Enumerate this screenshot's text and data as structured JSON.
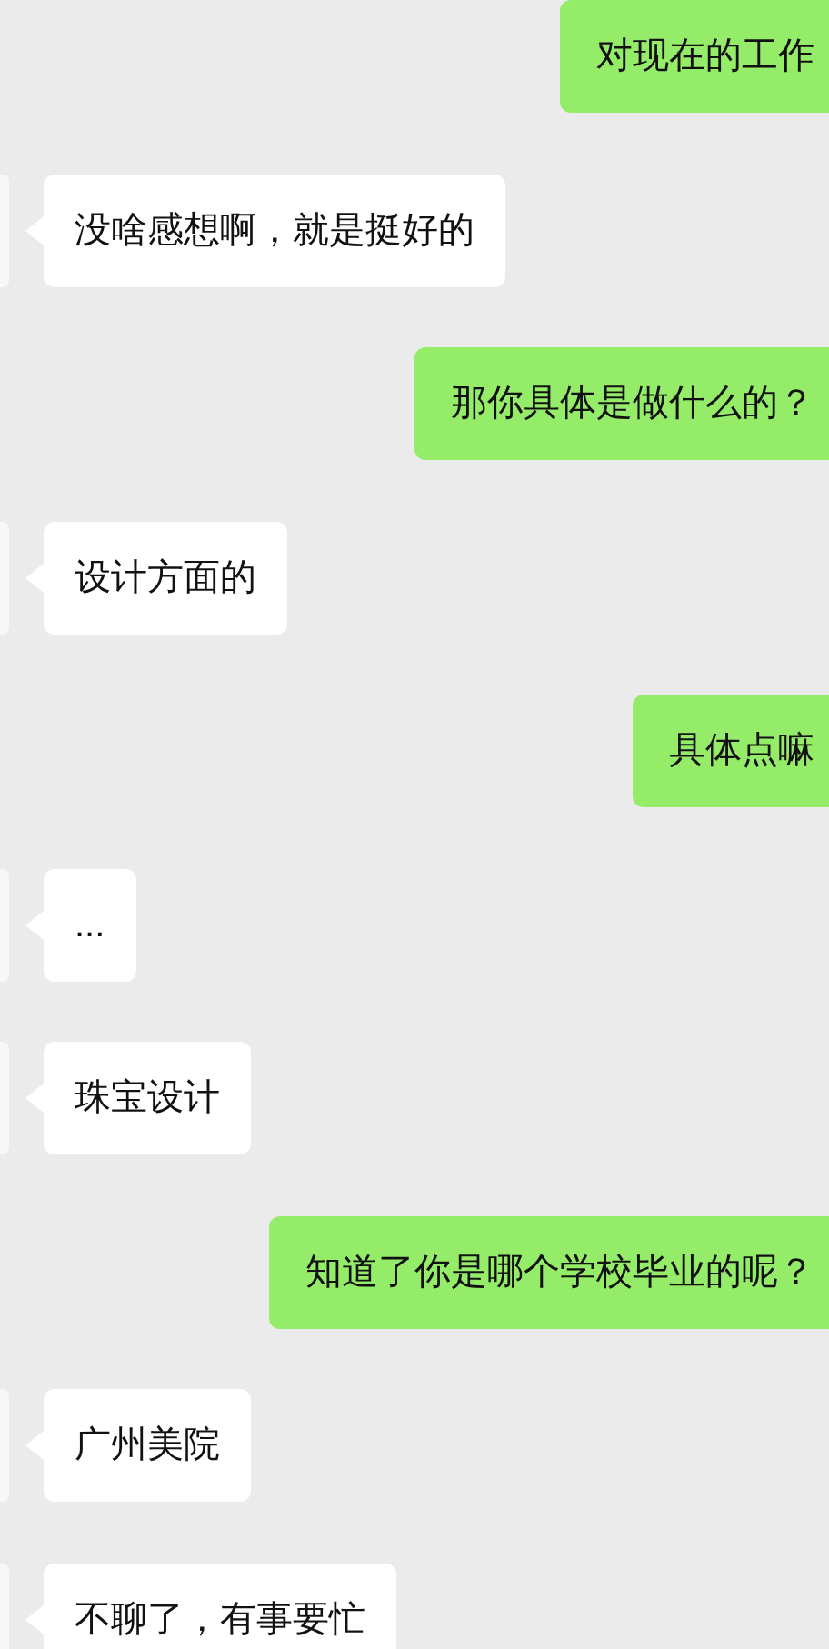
{
  "messages": [
    {
      "kind": "sent",
      "text": "对现在的工作"
    },
    {
      "kind": "received",
      "text": "没啥感想啊，就是挺好的"
    },
    {
      "kind": "sent",
      "text": "那你具体是做什么的？"
    },
    {
      "kind": "received",
      "text": "设计方面的"
    },
    {
      "kind": "sent",
      "text": "具体点嘛"
    },
    {
      "kind": "received",
      "text": "..."
    },
    {
      "kind": "received",
      "text": "珠宝设计"
    },
    {
      "kind": "sent",
      "text": "知道了你是哪个学校毕业的呢？"
    },
    {
      "kind": "received",
      "text": "广州美院"
    },
    {
      "kind": "received",
      "text": "不聊了，有事要忙"
    }
  ]
}
